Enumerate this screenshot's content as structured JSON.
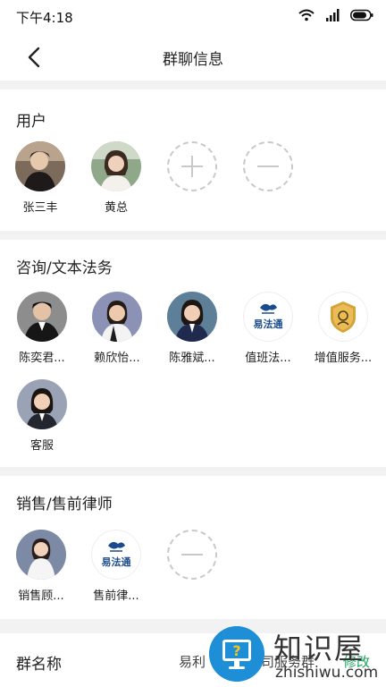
{
  "status_bar": {
    "time": "下午4:18"
  },
  "header": {
    "title": "群聊信息"
  },
  "users": {
    "title": "用户",
    "members": [
      {
        "name": "张三丰"
      },
      {
        "name": "黄总"
      }
    ]
  },
  "consult": {
    "title": "咨询/文本法务",
    "members": [
      {
        "name": "陈奕君..."
      },
      {
        "name": "赖欣怡..."
      },
      {
        "name": "陈雅斌..."
      },
      {
        "name": "值班法..."
      },
      {
        "name": "增值服务..."
      },
      {
        "name": "客服"
      }
    ],
    "brand_text": "易法通"
  },
  "sales": {
    "title": "销售/售前律师",
    "members": [
      {
        "name": "销售顾..."
      },
      {
        "name": "售前律..."
      }
    ],
    "brand_text": "易法通"
  },
  "group_name": {
    "label": "群名称",
    "value": "易利",
    "value_tail": "司服务群",
    "modify": "修改"
  },
  "watermark": {
    "name": "知识屋",
    "domain": "zhishiwu.com"
  },
  "colors": {
    "accent_green": "#1aa15b",
    "watermark_blue": "#1e8fd6",
    "dashed_gray": "#c9c9c9"
  }
}
